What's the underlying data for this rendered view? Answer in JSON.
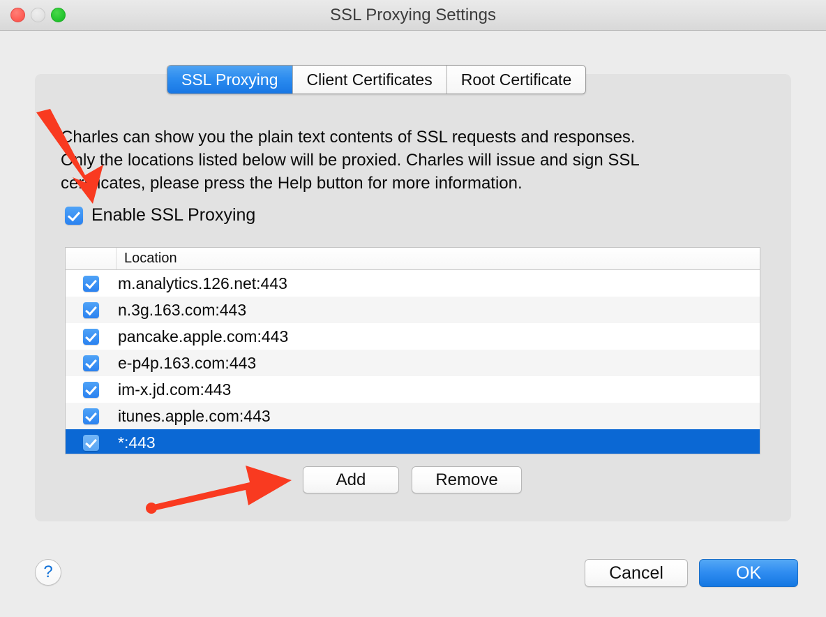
{
  "window": {
    "title": "SSL Proxying Settings",
    "traffic_lights": [
      "close",
      "minimize",
      "maximize"
    ]
  },
  "tabs": [
    {
      "label": "SSL Proxying",
      "active": true
    },
    {
      "label": "Client Certificates",
      "active": false
    },
    {
      "label": "Root Certificate",
      "active": false
    }
  ],
  "description": {
    "line1": "Charles can show you the plain text contents of SSL requests and responses.",
    "line2": "Only the locations listed below will be proxied. Charles will issue and sign SSL",
    "line3": "certificates, please press the Help button for more information."
  },
  "enable": {
    "label": "Enable SSL Proxying",
    "checked": true
  },
  "table": {
    "column_header": "Location",
    "rows": [
      {
        "location": "m.analytics.126.net:443",
        "checked": true,
        "selected": false
      },
      {
        "location": "n.3g.163.com:443",
        "checked": true,
        "selected": false
      },
      {
        "location": "pancake.apple.com:443",
        "checked": true,
        "selected": false
      },
      {
        "location": "e-p4p.163.com:443",
        "checked": true,
        "selected": false
      },
      {
        "location": "im-x.jd.com:443",
        "checked": true,
        "selected": false
      },
      {
        "location": "itunes.apple.com:443",
        "checked": true,
        "selected": false
      },
      {
        "location": "*:443",
        "checked": true,
        "selected": true
      }
    ]
  },
  "list_actions": {
    "add_label": "Add",
    "remove_label": "Remove"
  },
  "footer": {
    "help_label": "?",
    "cancel_label": "Cancel",
    "ok_label": "OK"
  },
  "colors": {
    "accent_blue": "#2b8bef",
    "selection_blue": "#0b68d4",
    "annotation_red": "#f93a20",
    "window_bg": "#ececec",
    "panel_bg": "#e2e2e2"
  },
  "annotations": [
    {
      "name": "arrow-to-enable-checkbox",
      "direction": "down-right"
    },
    {
      "name": "arrow-to-add-button",
      "direction": "right"
    }
  ]
}
